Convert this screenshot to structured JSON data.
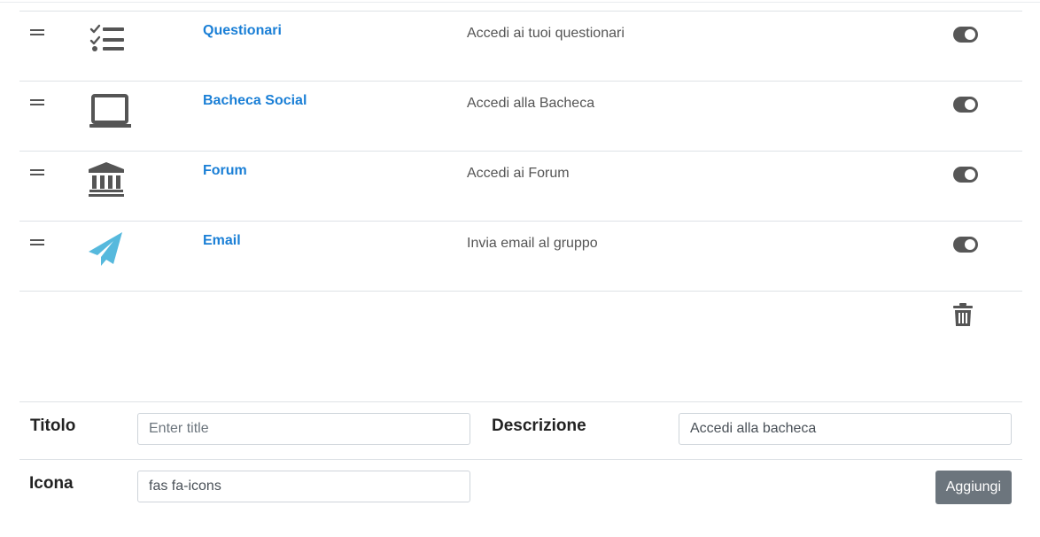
{
  "items": [
    {
      "title": "Questionari",
      "description": "Accedi ai tuoi questionari",
      "icon": "list-check-icon",
      "enabled": true
    },
    {
      "title": "Bacheca Social",
      "description": "Accedi alla Bacheca",
      "icon": "laptop-icon",
      "enabled": true
    },
    {
      "title": "Forum",
      "description": "Accedi ai Forum",
      "icon": "landmark-icon",
      "enabled": true
    },
    {
      "title": "Email",
      "description": "Invia email al gruppo",
      "icon": "paper-plane-icon",
      "enabled": true
    }
  ],
  "colors": {
    "link": "#1a7fd6",
    "icon": "#555555",
    "email_icon": "#56b9dd",
    "toggle": "#575757",
    "button": "#6c757d"
  },
  "form": {
    "title_label": "Titolo",
    "title_placeholder": "Enter title",
    "title_value": "",
    "description_label": "Descrizione",
    "description_value": "Accedi alla bacheca",
    "icon_label": "Icona",
    "icon_value": "fas fa-icons",
    "add_button": "Aggiungi"
  },
  "delete_icon": "trash-icon"
}
